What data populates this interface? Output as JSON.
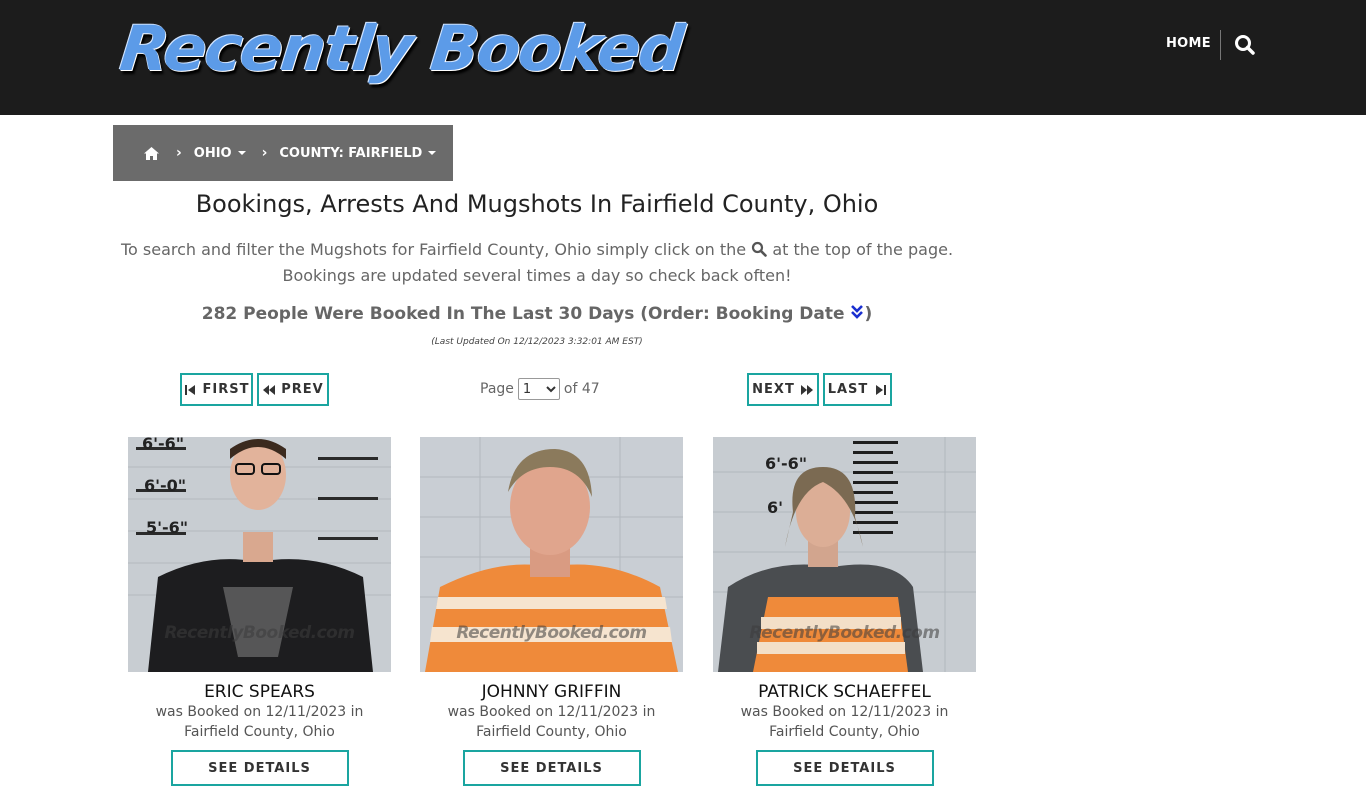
{
  "header": {
    "logo_text": "Recently Booked",
    "nav_home": "HOME",
    "search_icon": "search-icon"
  },
  "breadcrumb": {
    "home_icon": "home-icon",
    "items": [
      {
        "label": "OHIO"
      },
      {
        "label": "COUNTY: FAIRFIELD"
      }
    ]
  },
  "main": {
    "title": "Bookings, Arrests And Mugshots In Fairfield County, Ohio",
    "intro_before": "To search and filter the Mugshots for Fairfield County, Ohio simply click on the",
    "intro_after": "at the top of the page. Bookings are updated several times a day so check back often!",
    "count_text": "282 People Were Booked In The Last 30 Days (Order: Booking Date",
    "count_close": ")",
    "last_updated": "(Last Updated On 12/12/2023 3:32:01 AM EST)"
  },
  "pagination": {
    "first": "FIRST",
    "prev": "PREV",
    "next": "NEXT",
    "last": "LAST",
    "page_label": "Page",
    "current_page": "1",
    "of_label": "of 47"
  },
  "bookings": [
    {
      "name": "ERIC SPEARS",
      "booked_line": "was Booked on 12/11/2023 in",
      "location": "Fairfield County, Ohio",
      "watermark": "RecentlyBooked.com",
      "button": "SEE DETAILS"
    },
    {
      "name": "JOHNNY GRIFFIN",
      "booked_line": "was Booked on 12/11/2023 in",
      "location": "Fairfield County, Ohio",
      "watermark": "RecentlyBooked.com",
      "button": "SEE DETAILS"
    },
    {
      "name": "PATRICK SCHAEFFEL",
      "booked_line": "was Booked on 12/11/2023 in",
      "location": "Fairfield County, Ohio",
      "watermark": "RecentlyBooked.com",
      "button": "SEE DETAILS"
    }
  ],
  "colors": {
    "header_bg": "#1c1c1c",
    "breadcrumb_bg": "#6b6b6b",
    "accent": "#1aa5a0",
    "logo_blue": "#5c9be8"
  }
}
